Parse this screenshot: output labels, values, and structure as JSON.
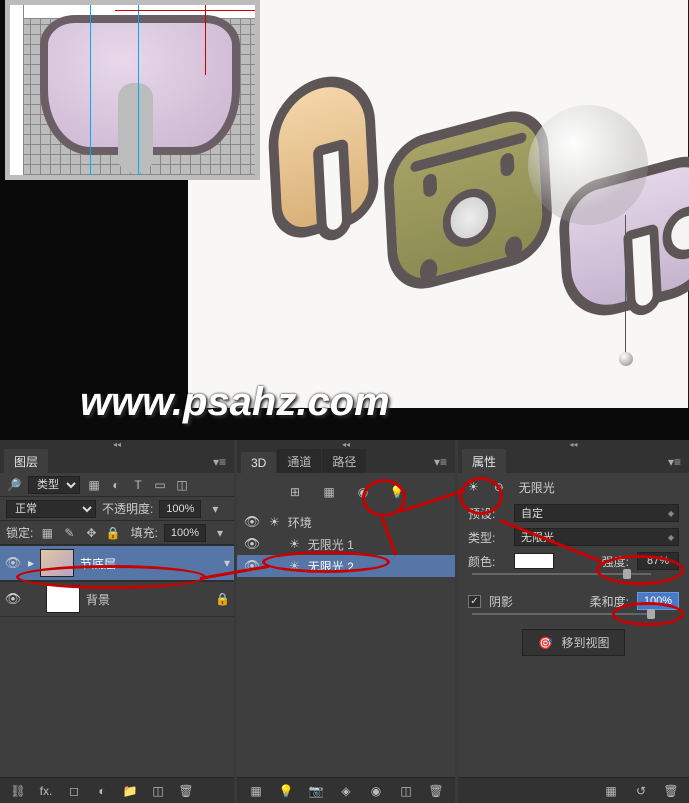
{
  "watermark": "www.psahz.com",
  "layers_panel": {
    "tab": "图层",
    "filter_label": "类型",
    "blend_mode": "正常",
    "opacity_label": "不透明度:",
    "opacity_value": "100%",
    "lock_label": "锁定:",
    "fill_label": "填充:",
    "fill_value": "100%",
    "layers": [
      {
        "name": "节底层",
        "selected": true
      },
      {
        "name": "背景",
        "selected": false
      }
    ]
  },
  "d3_panel": {
    "tabs": [
      "3D",
      "通道",
      "路径"
    ],
    "items": [
      {
        "name": "环境",
        "icon": "sun",
        "selected": false
      },
      {
        "name": "无限光 1",
        "icon": "sun",
        "selected": false
      },
      {
        "name": "无限光 2",
        "icon": "sun",
        "selected": true
      }
    ]
  },
  "props_panel": {
    "tab": "属性",
    "title": "无限光",
    "preset_label": "预设:",
    "preset_value": "自定",
    "type_label": "类型:",
    "type_value": "无限光",
    "color_label": "颜色:",
    "intensity_label": "强度:",
    "intensity_value": "87%",
    "shadow_label": "阴影",
    "softness_label": "柔和度:",
    "softness_value": "100%",
    "move_to_view": "移到视图"
  },
  "footer_icons": {
    "link": "⛓",
    "fx": "fx.",
    "mask": "◻",
    "adjust": "◐",
    "folder": "📁",
    "new": "◫",
    "trash": "🗑"
  }
}
